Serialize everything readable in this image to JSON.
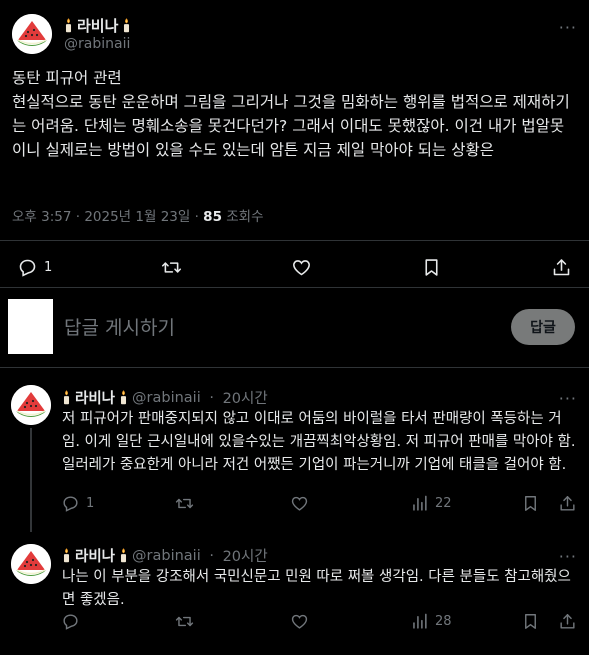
{
  "main_post": {
    "display_name": "라비나",
    "handle": "@rabinaii",
    "more": "···",
    "text": "동탄 피규어 관련\n현실적으로 동탄 운운하며 그림을 그리거나 그것을 밈화하는 행위를 법적으로 제재하기는 어려움. 단체는 명훼소송을 못건다던가? 그래서 이대도 못했잖아. 이건 내가 법알못이니 실제로는 방법이 있을 수도 있는데 암튼 지금 제일 막아야 되는 상황은",
    "time": "오후 3:57 · 2025년 1월 23일 · ",
    "views_count": "85",
    "views_label": " 조회수",
    "reply_count": "1"
  },
  "composer": {
    "placeholder": "답글 게시하기",
    "button_label": "답글"
  },
  "replies": [
    {
      "display_name": "라비나",
      "handle": "@rabinaii",
      "separator": " · ",
      "time": "20시간",
      "more": "···",
      "text": "저 피규어가 판매중지되지 않고 이대로 어둠의 바이럴을 타서 판매량이 폭등하는 거임. 이게 일단 근시일내에 있을수있는 개끔찍최악상황임. 저 피규어 판매를 막아야 함. 일러레가 중요한게 아니라 저건 어쨌든 기업이 파는거니까 기업에 태클을 걸어야 함.",
      "reply_count": "1",
      "views": "22"
    },
    {
      "display_name": "라비나",
      "handle": "@rabinaii",
      "separator": " · ",
      "time": "20시간",
      "more": "···",
      "text": "나는 이 부분을 강조해서 국민신문고 민원 따로 쩌볼 생각임. 다른 분들도 참고해줬으면 좋겠음.",
      "reply_count": "",
      "views": "28"
    }
  ],
  "icons": [
    "candle-icon",
    "reply-icon",
    "retweet-icon",
    "like-icon",
    "bookmark-icon",
    "share-icon",
    "views-icon",
    "watermelon-avatar"
  ],
  "colors": {
    "background": "#000000",
    "text": "#e7e9ea",
    "muted": "#71767b",
    "divider": "#2f3336",
    "reply_button": "#787a7a"
  }
}
